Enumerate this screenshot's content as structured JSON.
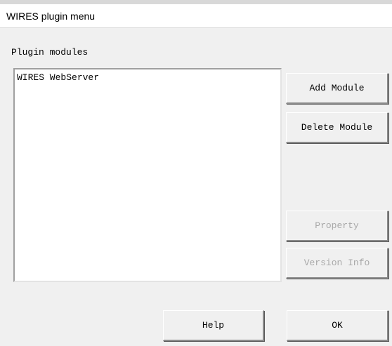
{
  "window": {
    "title": "WIRES plugin menu"
  },
  "plugin_modules": {
    "label": "Plugin modules",
    "items": [
      "WIRES WebServer"
    ]
  },
  "buttons": {
    "add_module": "Add Module",
    "delete_module": "Delete Module",
    "property": "Property",
    "version_info": "Version Info",
    "help": "Help",
    "ok": "OK"
  },
  "colors": {
    "background": "#f0f0f0",
    "title_bar": "#ffffff",
    "disabled_text": "#a8a8a8"
  }
}
